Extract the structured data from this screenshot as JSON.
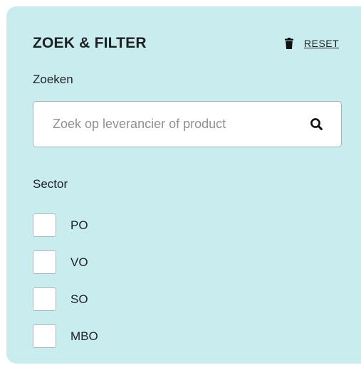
{
  "filter": {
    "title": "ZOEK & FILTER",
    "reset_label": "RESET",
    "reset_icon": "trash-icon",
    "search_section_label": "Zoeken",
    "search": {
      "placeholder": "Zoek op leverancier of product",
      "value": "",
      "icon": "search-icon"
    },
    "sector": {
      "label": "Sector",
      "options": [
        {
          "label": "PO",
          "checked": false
        },
        {
          "label": "VO",
          "checked": false
        },
        {
          "label": "SO",
          "checked": false
        },
        {
          "label": "MBO",
          "checked": false
        }
      ]
    }
  },
  "colors": {
    "panel_background": "#c9ecee",
    "text": "#1e2124",
    "placeholder": "#8e9193"
  }
}
